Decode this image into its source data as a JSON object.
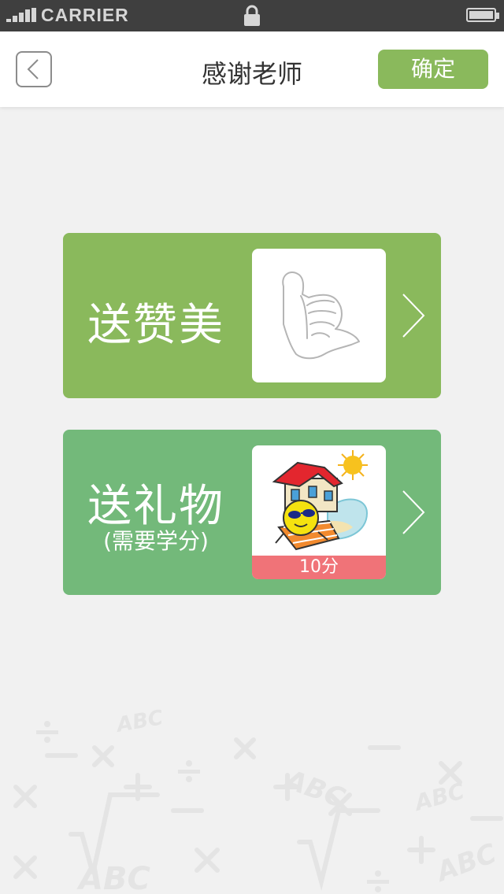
{
  "status_bar": {
    "carrier": "CARRIER",
    "signal_icon": "signal-bars-icon",
    "lock_icon": "lock-icon",
    "battery_icon": "battery-icon"
  },
  "nav": {
    "title": "感谢老师",
    "confirm_label": "确定",
    "back_icon": "chevron-left-icon"
  },
  "cards": {
    "praise": {
      "title": "送赞美",
      "image_icon": "thumbs-up-icon",
      "arrow_icon": "chevron-right-icon"
    },
    "gift": {
      "title": "送礼物",
      "subtitle": "(需要学分)",
      "image_icon": "beach-house-sticker",
      "price": "10分",
      "arrow_icon": "chevron-right-icon"
    }
  },
  "colors": {
    "status_bar_bg": "#3f3f3f",
    "accent_green": "#8ab95c",
    "gift_green": "#73b97a",
    "price_red": "#f07378",
    "page_bg": "#f1f1f1"
  }
}
